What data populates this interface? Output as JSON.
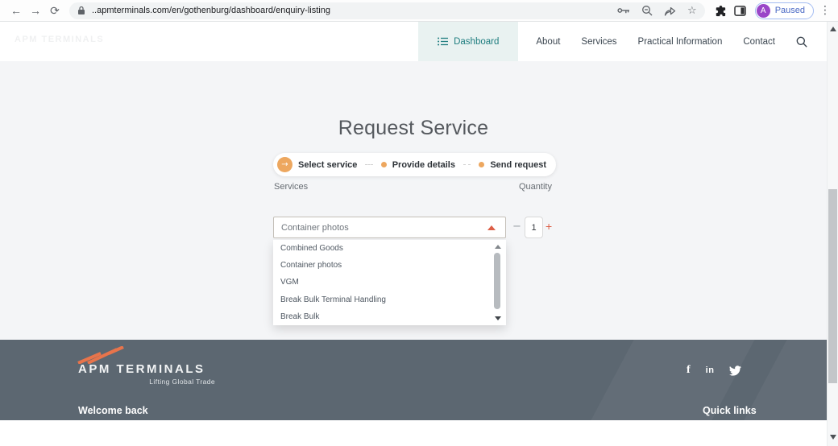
{
  "browser": {
    "url": "..apmterminals.com/en/gothenburg/dashboard/enquiry-listing",
    "profile": {
      "initial": "A",
      "status": "Paused"
    }
  },
  "glyphs": {
    "back": "←",
    "forward": "→",
    "reload": "⟳",
    "bookmark": "☆",
    "menu": "⋮",
    "step_arrow": "→",
    "minus": "−",
    "plus": "+",
    "facebook": "f",
    "linkedin": "in"
  },
  "header": {
    "watermark": "APM TERMINALS",
    "nav": {
      "dashboard": "Dashboard",
      "about": "About",
      "services": "Services",
      "practical_information": "Practical Information",
      "contact": "Contact"
    }
  },
  "main": {
    "title": "Request Service",
    "steps": [
      {
        "label": "Select service"
      },
      {
        "label": "Provide details"
      },
      {
        "label": "Send request"
      }
    ],
    "form": {
      "services_label": "Services",
      "services_value": "Container photos",
      "quantity_label": "Quantity",
      "quantity_value": "1"
    },
    "dropdown_options": [
      "Combined Goods",
      "Container photos",
      "VGM",
      "Break Bulk Terminal Handling",
      "Break Bulk"
    ]
  },
  "footer": {
    "brand": "APM TERMINALS",
    "tagline": "Lifting Global Trade",
    "welcome": "Welcome back",
    "quick_links": "Quick links"
  },
  "colors": {
    "brand_orange": "#e8744b",
    "accent_red_orange": "#dd5f47",
    "step_orange": "#eda75f",
    "dashboard_teal": "#1e7d7f",
    "dashboard_bg": "#e9f2f1",
    "footer_bg": "#5c6771",
    "content_bg": "#f4f5f7",
    "avatar_purple": "#9a46c8",
    "paused_blue": "#4968c4"
  }
}
